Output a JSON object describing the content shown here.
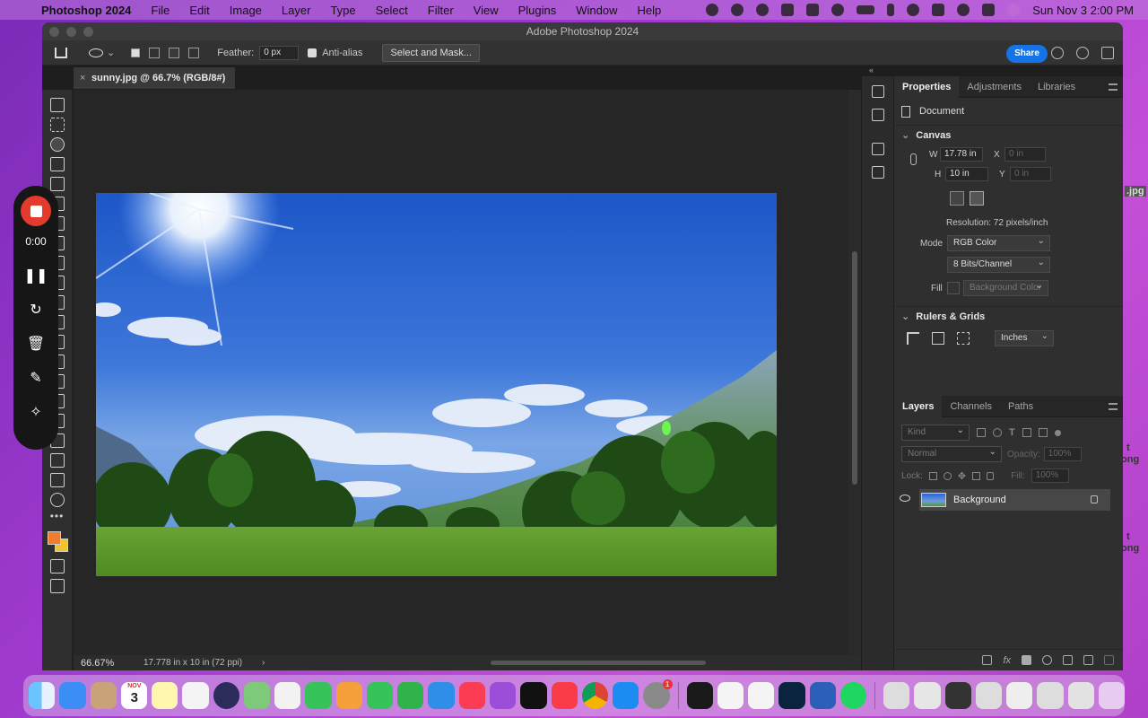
{
  "menubar": {
    "app_name": "Photoshop 2024",
    "items": [
      "File",
      "Edit",
      "Image",
      "Layer",
      "Type",
      "Select",
      "Filter",
      "View",
      "Plugins",
      "Window",
      "Help"
    ],
    "clock": "Sun Nov 3  2:00 PM"
  },
  "window": {
    "title": "Adobe Photoshop 2024"
  },
  "options_bar": {
    "feather_label": "Feather:",
    "feather_value": "0 px",
    "antialias_label": "Anti-alias",
    "select_mask_label": "Select and Mask...",
    "share_label": "Share"
  },
  "document": {
    "tab_label": "sunny.jpg @ 66.7% (RGB/8#)",
    "close_glyph": "×"
  },
  "status": {
    "zoom": "66.67%",
    "doc_info": "17.778 in x 10 in (72 ppi)",
    "arrow": "›"
  },
  "properties": {
    "tabs": [
      "Properties",
      "Adjustments",
      "Libraries"
    ],
    "doc_label": "Document",
    "canvas_heading": "Canvas",
    "w_label": "W",
    "w_value": "17.78 in",
    "h_label": "H",
    "h_value": "10 in",
    "x_label": "X",
    "x_value": "0 in",
    "y_label": "Y",
    "y_value": "0 in",
    "resolution": "Resolution: 72 pixels/inch",
    "mode_label": "Mode",
    "mode_value": "RGB Color",
    "bits_value": "8 Bits/Channel",
    "fill_label": "Fill",
    "fill_value": "Background Color",
    "rulers_heading": "Rulers & Grids",
    "units_value": "Inches"
  },
  "layers": {
    "tabs": [
      "Layers",
      "Channels",
      "Paths"
    ],
    "kind_placeholder": "Kind",
    "blend_mode": "Normal",
    "opacity_label": "Opacity:",
    "opacity_value": "100%",
    "lock_label": "Lock:",
    "fill_label": "Fill:",
    "fill_value": "100%",
    "layer_name": "Background"
  },
  "recorder": {
    "time": "0:00"
  },
  "dock": {
    "calendar_month": "NOV",
    "calendar_day": "3",
    "badge": "1"
  },
  "background_window": {
    "label_jpg": ".jpg",
    "label_t1": "t",
    "label_ong1": "ong",
    "label_t2": "t",
    "label_ong2": "ong"
  }
}
